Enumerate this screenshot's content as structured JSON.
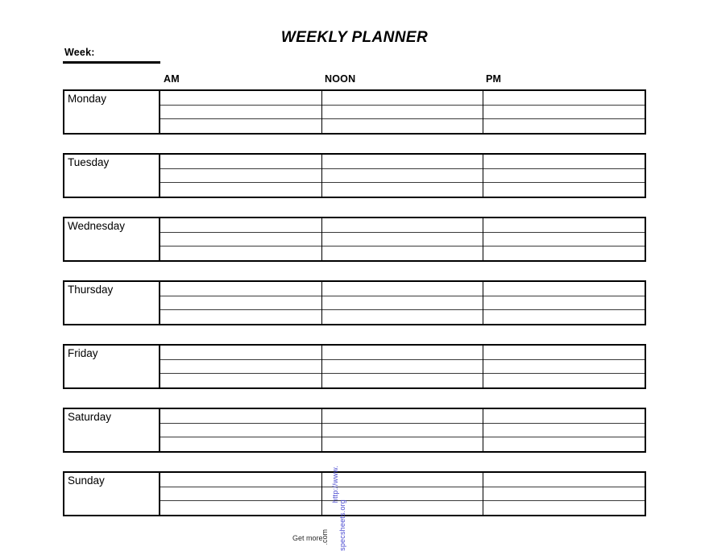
{
  "page": {
    "title": "WEEKLY PLANNER",
    "background_color": "#ffffff",
    "ink_color": "#000000"
  },
  "week_field": {
    "label": "Week:",
    "value": ""
  },
  "columns": [
    {
      "key": "am",
      "label": "AM"
    },
    {
      "key": "noon",
      "label": "NOON"
    },
    {
      "key": "pm",
      "label": "PM"
    }
  ],
  "days": [
    {
      "name": "Monday",
      "am": [
        "",
        "",
        ""
      ],
      "noon": [
        "",
        "",
        ""
      ],
      "pm": [
        "",
        "",
        ""
      ]
    },
    {
      "name": "Tuesday",
      "am": [
        "",
        "",
        ""
      ],
      "noon": [
        "",
        "",
        ""
      ],
      "pm": [
        "",
        "",
        ""
      ]
    },
    {
      "name": "Wednesday",
      "am": [
        "",
        "",
        ""
      ],
      "noon": [
        "",
        "",
        ""
      ],
      "pm": [
        "",
        "",
        ""
      ]
    },
    {
      "name": "Thursday",
      "am": [
        "",
        "",
        ""
      ],
      "noon": [
        "",
        "",
        ""
      ],
      "pm": [
        "",
        "",
        ""
      ]
    },
    {
      "name": "Friday",
      "am": [
        "",
        "",
        ""
      ],
      "noon": [
        "",
        "",
        ""
      ],
      "pm": [
        "",
        "",
        ""
      ]
    },
    {
      "name": "Saturday",
      "am": [
        "",
        "",
        ""
      ],
      "noon": [
        "",
        "",
        ""
      ],
      "pm": [
        "",
        "",
        ""
      ]
    },
    {
      "name": "Sunday",
      "am": [
        "",
        "",
        ""
      ],
      "noon": [
        "",
        "",
        ""
      ],
      "pm": [
        "",
        "",
        ""
      ]
    }
  ],
  "watermark": {
    "url_line": "http://www.",
    "url_line2": "specsheets.org",
    "get_more": "Get more",
    "com_suffix": ".com",
    "color": "#4a4ad0"
  }
}
